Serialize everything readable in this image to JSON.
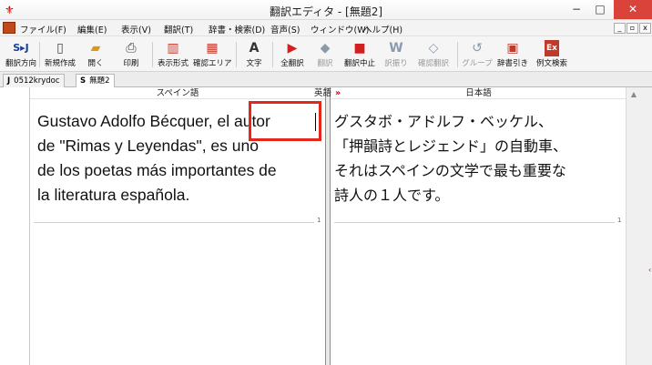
{
  "window": {
    "title": "翻訳エディタ - [無題2]",
    "minimize": "−",
    "maximize": "□",
    "close": "✕"
  },
  "menu": {
    "items": [
      "ファイル(F)",
      "編集(E)",
      "表示(V)",
      "翻訳(T)",
      "辞書・検索(D)",
      "音声(S)",
      "ウィンドウ(W)",
      "ヘルプ(H)"
    ],
    "mdi_min": "_",
    "mdi_max": "▫",
    "mdi_close": "x"
  },
  "toolbar": {
    "items": [
      {
        "label": "翻訳方向",
        "icon": "S▸J",
        "enabled": true
      },
      {
        "label": "新規作成",
        "icon": "▯",
        "enabled": true
      },
      {
        "label": "開く",
        "icon": "▰",
        "enabled": true
      },
      {
        "label": "印刷",
        "icon": "⎙",
        "enabled": true
      },
      {
        "label": "表示形式",
        "icon": "▥",
        "enabled": true
      },
      {
        "label": "確認エリア",
        "icon": "▦",
        "enabled": true
      },
      {
        "label": "文字",
        "icon": "A",
        "enabled": true
      },
      {
        "label": "全翻訳",
        "icon": "▶",
        "enabled": true
      },
      {
        "label": "翻訳",
        "icon": "◆",
        "enabled": false
      },
      {
        "label": "翻訳中止",
        "icon": "■",
        "enabled": true
      },
      {
        "label": "訳振り",
        "icon": "W",
        "enabled": false
      },
      {
        "label": "確認翻訳",
        "icon": "◇",
        "enabled": false
      },
      {
        "label": "グループ",
        "icon": "↺",
        "enabled": false
      },
      {
        "label": "辞書引き",
        "icon": "▣",
        "enabled": true
      },
      {
        "label": "例文検索",
        "icon": "Ex",
        "enabled": true
      }
    ]
  },
  "tabs": [
    {
      "letter": "J",
      "label": "0512krydoc",
      "active": false
    },
    {
      "letter": "S",
      "label": "無題2",
      "active": true
    }
  ],
  "editor": {
    "source_header": "スペイン語",
    "swap_label": "英語",
    "swap_arrow": "»",
    "target_header": "日本語",
    "source_lines": [
      "Gustavo Adolfo Bécquer, el autor",
      "de \"Rimas y Leyendas\", es uno",
      "de los poetas más importantes de",
      "la literatura española."
    ],
    "target_lines": [
      "グスタボ・アドルフ・ベッケル、",
      "「押韻詩とレジェンド」の自動車、",
      "それはスペインの文学で最も重要な",
      "詩人の１人です。"
    ],
    "source_end_marker": "1",
    "target_end_marker": "1"
  },
  "colors": {
    "highlight_box": "#e3271b",
    "close_button": "#d9433a"
  }
}
